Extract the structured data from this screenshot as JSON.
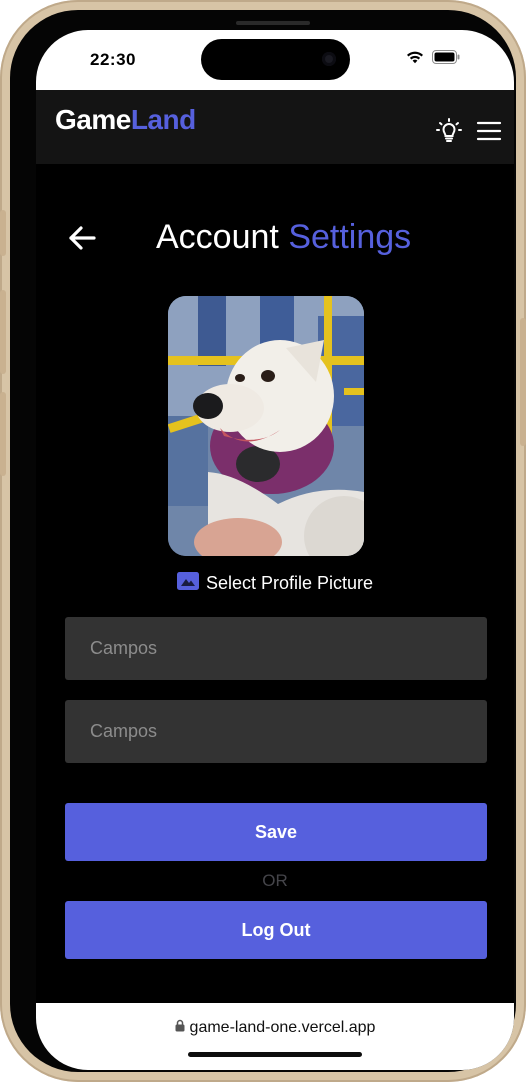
{
  "status_bar": {
    "time": "22:30",
    "wifi_icon": "wifi-icon",
    "battery_icon": "battery-icon"
  },
  "header": {
    "brand_main": "Game",
    "brand_accent": "Land",
    "theme_icon": "lightbulb-icon",
    "menu_icon": "hamburger-menu-icon"
  },
  "page": {
    "back_icon": "arrow-left-icon",
    "title_main": "Account",
    "title_accent": "Settings"
  },
  "profile": {
    "avatar_content": "photo of a white dog wearing a purple harness on a bus",
    "select_icon": "image-icon",
    "select_label": "Select Profile Picture"
  },
  "form": {
    "field_1_placeholder": "Campos",
    "field_1_value": "",
    "field_2_placeholder": "Campos",
    "field_2_value": "",
    "save_label": "Save",
    "or_label": "OR",
    "logout_label": "Log Out"
  },
  "browser": {
    "lock_icon": "lock-icon",
    "url": "game-land-one.vercel.app"
  },
  "colors": {
    "accent": "#5660dd",
    "background": "#000000",
    "header_bg": "#141414",
    "field_bg": "#333333",
    "phone_frame": "#d7c4a6"
  }
}
